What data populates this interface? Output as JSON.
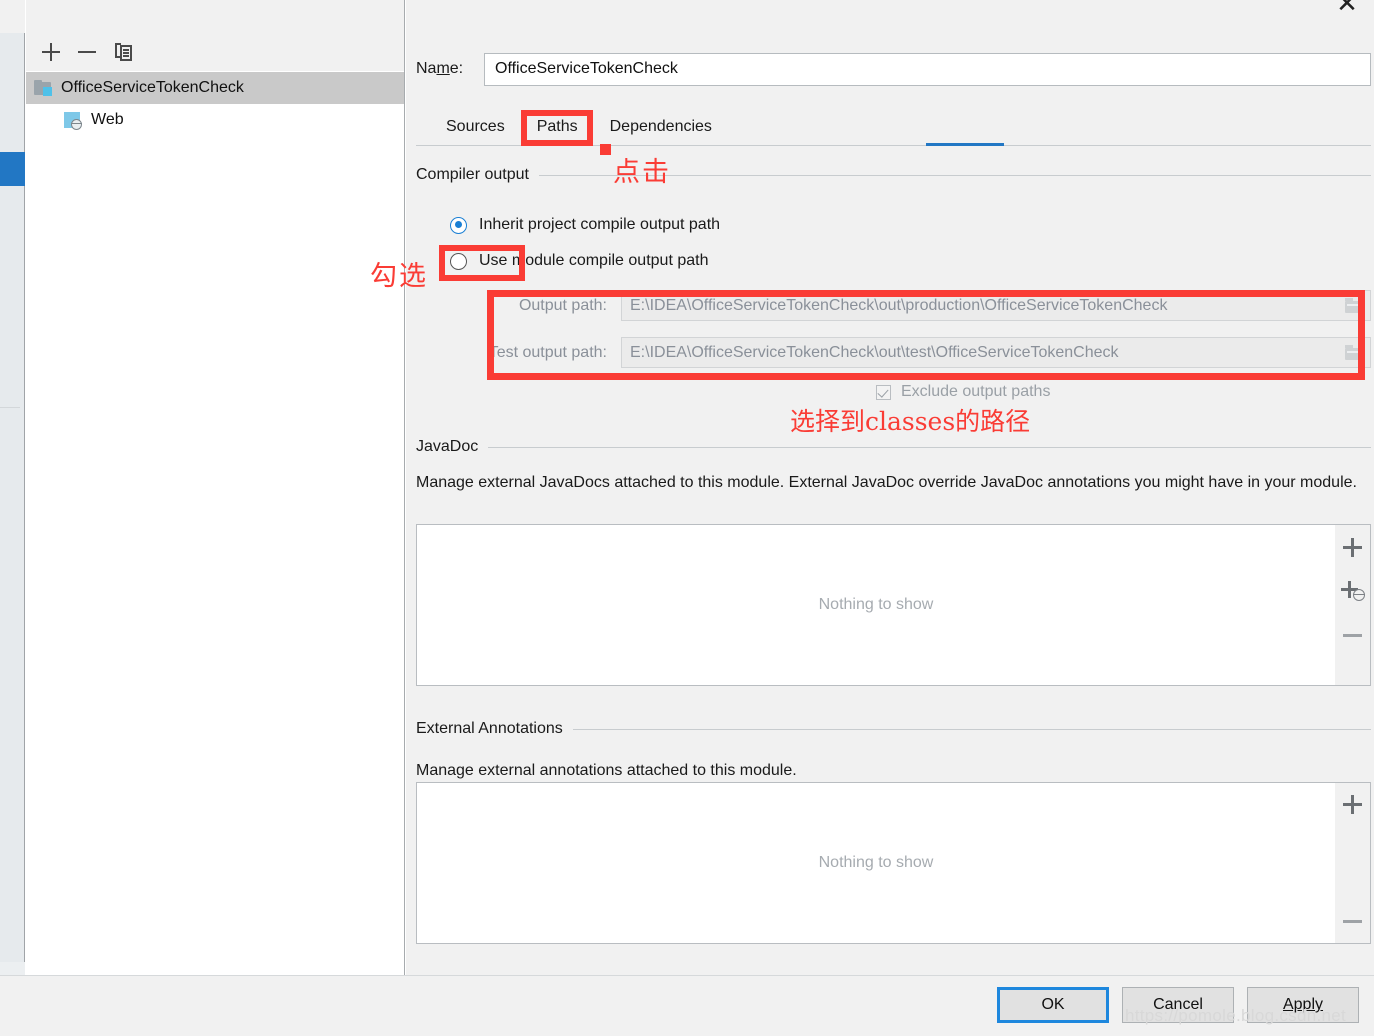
{
  "window": {
    "close_icon": "close-icon"
  },
  "tree_toolbar": {
    "add_label": "+",
    "remove_label": "−",
    "copy_label": "copy"
  },
  "tree": {
    "items": [
      {
        "label": "OfficeServiceTokenCheck",
        "icon": "module-folder-icon",
        "selected": true
      },
      {
        "label": "Web",
        "icon": "web-facet-icon",
        "selected": false
      }
    ]
  },
  "name_field": {
    "label_prefix": "Na",
    "label_mnemonic": "m",
    "label_suffix": "e:",
    "label_full": "Name:",
    "value": "OfficeServiceTokenCheck"
  },
  "tabs": [
    {
      "label": "Sources",
      "active": false
    },
    {
      "label": "Paths",
      "active": true
    },
    {
      "label": "Dependencies",
      "active": false
    }
  ],
  "compiler_output": {
    "group_title": "Compiler output",
    "radio_inherit": "Inherit project compile output path",
    "radio_module": "Use module compile output path",
    "selected": "inherit",
    "output_path_label": "Output path:",
    "output_path_value": "E:\\IDEA\\OfficeServiceTokenCheck\\out\\production\\OfficeServiceTokenCheck",
    "test_output_path_label": "Test output path:",
    "test_output_path_value": "E:\\IDEA\\OfficeServiceTokenCheck\\out\\test\\OfficeServiceTokenCheck",
    "exclude_label": "Exclude output paths",
    "exclude_checked": true,
    "browse_icon": "folder-browse-icon"
  },
  "javadoc": {
    "group_title": "JavaDoc",
    "description": "Manage external JavaDocs attached to this module. External JavaDoc override JavaDoc annotations you might have in your module.",
    "empty_text": "Nothing to show",
    "buttons": [
      {
        "name": "add-javadoc-button",
        "icon": "plus-icon"
      },
      {
        "name": "add-javadoc-url-button",
        "icon": "plus-globe-icon"
      },
      {
        "name": "remove-javadoc-button",
        "icon": "minus-icon"
      }
    ]
  },
  "external_annotations": {
    "group_title": "External Annotations",
    "description": "Manage external annotations attached to this module.",
    "empty_text": "Nothing to show",
    "buttons": [
      {
        "name": "add-annotation-button",
        "icon": "plus-icon"
      },
      {
        "name": "remove-annotation-button",
        "icon": "minus-icon"
      }
    ]
  },
  "dialog_buttons": {
    "ok": "OK",
    "cancel": "Cancel",
    "apply_prefix": "",
    "apply_mnemonic": "A",
    "apply_suffix": "pply",
    "apply_full": "Apply"
  },
  "annotations": {
    "click_text": "点击",
    "check_text": "勾选",
    "classes_text": "选择到classes的路径",
    "accent_color": "#fa3c35",
    "highlight_color": "#2277c4"
  },
  "watermark": {
    "text": "https://pomole.blog.csdn.net"
  }
}
